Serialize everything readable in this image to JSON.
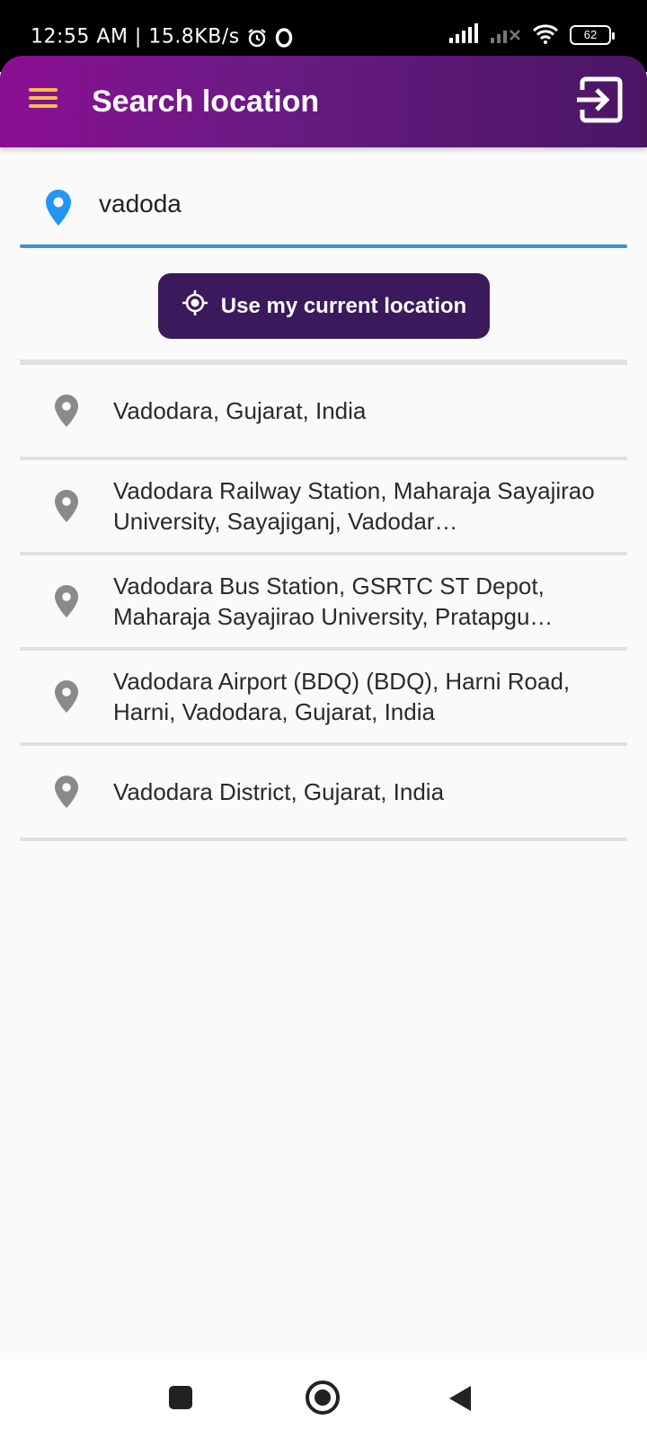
{
  "status_bar": {
    "time": "12:55 AM | 15.8KB/s",
    "battery": "62"
  },
  "app_bar": {
    "title": "Search location",
    "menu_color": "#f4c04a"
  },
  "search": {
    "value": "vadoda",
    "placeholder": "",
    "pin_color": "#2196f3",
    "underline_color": "#3d8fd3"
  },
  "current_location_button": {
    "label": "Use my current location",
    "background": "#3a1a5c"
  },
  "results": [
    {
      "label": "Vadodara, Gujarat, India"
    },
    {
      "label": "Vadodara Railway Station, Maharaja Sayajirao University, Sayajiganj, Vadodar…"
    },
    {
      "label": "Vadodara Bus Station, GSRTC ST Depot, Maharaja Sayajirao University, Pratapgu…"
    },
    {
      "label": "Vadodara Airport (BDQ) (BDQ), Harni Road, Harni, Vadodara, Gujarat, India"
    },
    {
      "label": "Vadodara District, Gujarat, India"
    }
  ],
  "icons": {
    "menu": "hamburger-icon",
    "exit": "exit-to-app-icon",
    "search_pin": "location-pin-icon",
    "current_location": "my-location-icon",
    "result_pin": "location-pin-icon"
  }
}
